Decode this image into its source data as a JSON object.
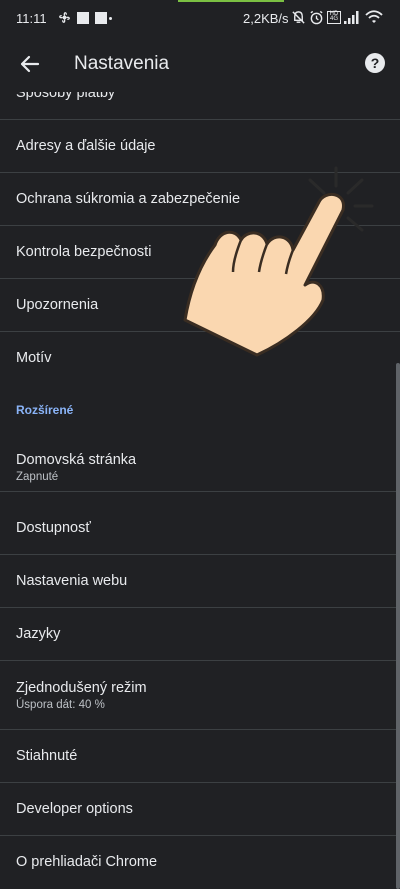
{
  "status_bar": {
    "time": "11:11",
    "speed": "2,2KB/s",
    "icons": [
      "fan-icon",
      "square-icon",
      "square-icon",
      "dot-icon",
      "alarm-off-icon",
      "alarm-icon",
      "volte-icon",
      "signal-icon",
      "wifi-icon"
    ]
  },
  "app_bar": {
    "back_icon": "arrow-back-icon",
    "title": "Nastavenia",
    "help_icon": "help-icon",
    "help_glyph": "?"
  },
  "list": {
    "partial_item": "Spôsoby platby",
    "items": [
      {
        "label": "Adresy a ďalšie údaje"
      },
      {
        "label": "Ochrana súkromia a zabezpečenie"
      },
      {
        "label": "Kontrola bezpečnosti"
      },
      {
        "label": "Upozornenia"
      },
      {
        "label": "Motív"
      }
    ],
    "section_header": "Rozšírené",
    "advanced": [
      {
        "label": "Domovská stránka",
        "sub": "Zapnuté"
      },
      {
        "label": "Dostupnosť"
      },
      {
        "label": "Nastavenia webu"
      },
      {
        "label": "Jazyky"
      },
      {
        "label": "Zjednodušený režim",
        "sub": "Úspora dát: 40 %"
      },
      {
        "label": "Stiahnuté"
      },
      {
        "label": "Developer options"
      },
      {
        "label": "O prehliadači Chrome"
      }
    ]
  },
  "overlay": {
    "icon": "tap-hand-icon"
  },
  "colors": {
    "background": "#202124",
    "accent": "#8ab4f8",
    "divider": "#3c4043"
  }
}
